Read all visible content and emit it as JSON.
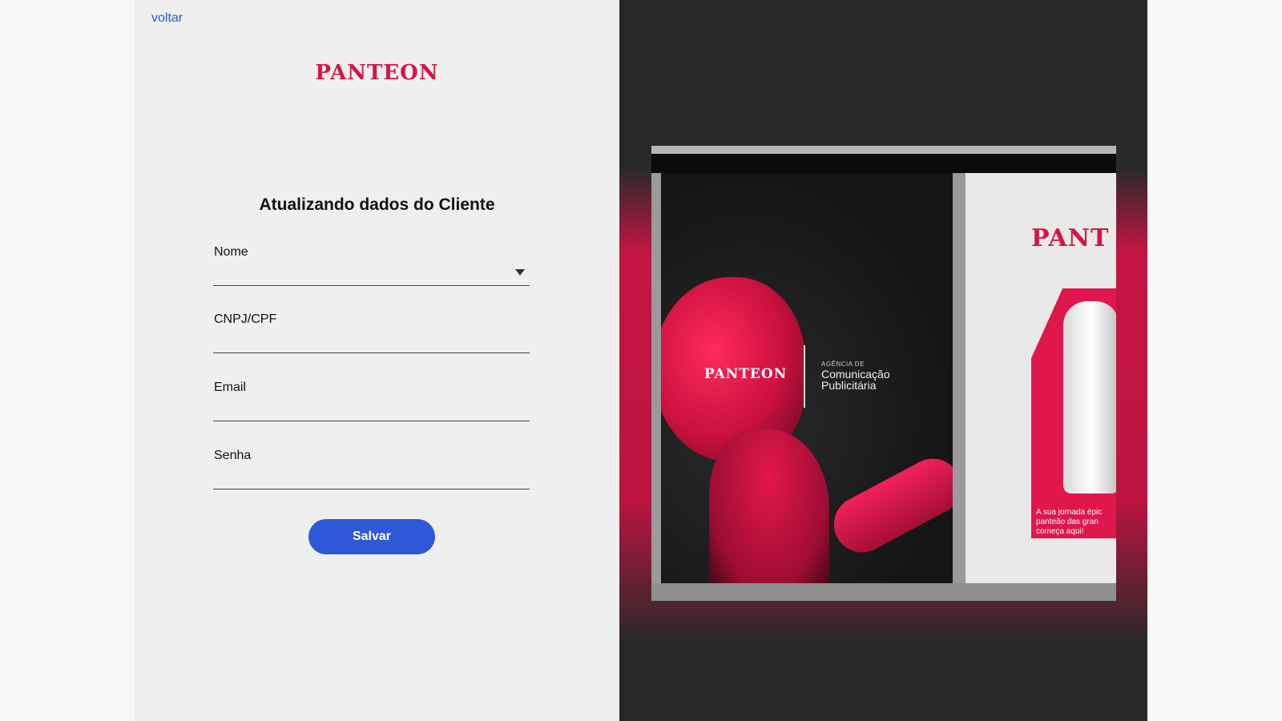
{
  "nav": {
    "back_label": "voltar"
  },
  "brand": {
    "logo_text": "PANTEON",
    "color": "#d31646"
  },
  "form": {
    "title": "Atualizando dados do Cliente",
    "fields": [
      {
        "label": "Nome",
        "value": "",
        "type": "select",
        "icon": "chevron-down-icon"
      },
      {
        "label": "CNPJ/CPF",
        "value": "",
        "type": "text"
      },
      {
        "label": "Email",
        "value": "",
        "type": "email"
      },
      {
        "label": "Senha",
        "value": "",
        "type": "password"
      }
    ],
    "submit_label": "Salvar",
    "accent": "#2f58d6"
  },
  "hero": {
    "poster_logo": "PANTEON",
    "poster_subtitle": "AGÊNCIA DE",
    "poster_tagline_line1": "Comunicação",
    "poster_tagline_line2": "Publicitária",
    "side_poster_logo": "PANT",
    "side_poster_text_line1": "A sua jornada épic",
    "side_poster_text_line2": "panteão das gran",
    "side_poster_text_line3": "começa aqui!",
    "accent": "#e0174c"
  }
}
